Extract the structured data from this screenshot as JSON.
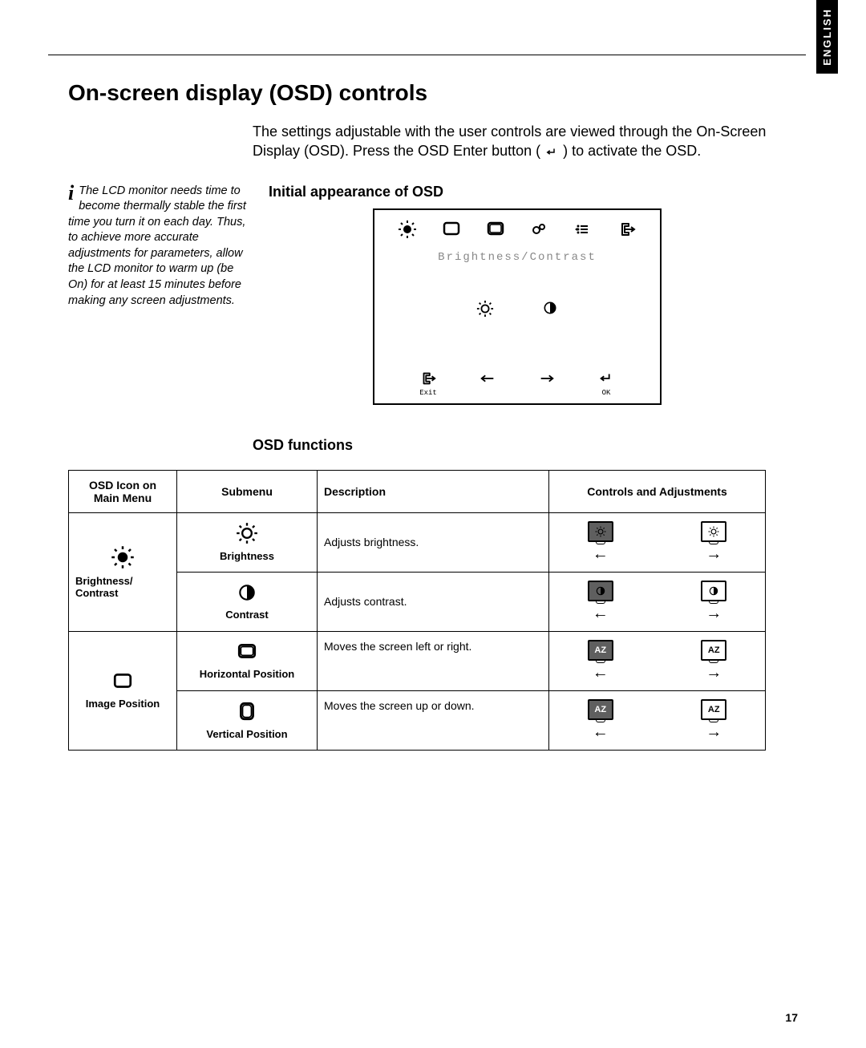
{
  "language_tab": "ENGLISH",
  "heading": "On-screen display (OSD) controls",
  "intro_before": "The settings adjustable with the user controls are viewed through the On-Screen Display (OSD). Press the OSD Enter button ( ",
  "intro_after": " ) to activate the OSD.",
  "note": "The LCD monitor needs time to become thermally stable the first time you turn it on each day. Thus, to achieve more accurate adjustments for parameters, allow the LCD monitor to warm up (be On) for at least 15 minutes before making any screen adjustments.",
  "subhead1": "Initial appearance of OSD",
  "osd": {
    "title": "Brightness/Contrast",
    "nav": {
      "exit": "Exit",
      "ok": "OK"
    }
  },
  "subhead2": "OSD functions",
  "table": {
    "headers": {
      "col1": "OSD Icon on Main Menu",
      "col2": "Submenu",
      "col3": "Description",
      "col4": "Controls and Adjustments"
    },
    "rows": {
      "group1_label": "Brightness/ Contrast",
      "r1_sub": "Brightness",
      "r1_desc": "Adjusts brightness.",
      "r2_sub": "Contrast",
      "r2_desc": "Adjusts contrast.",
      "group2_label": "Image Position",
      "r3_sub": "Horizontal Position",
      "r3_desc": "Moves the screen left or right.",
      "r4_sub": "Vertical Position",
      "r4_desc": "Moves the screen up or down."
    }
  },
  "page": "17"
}
